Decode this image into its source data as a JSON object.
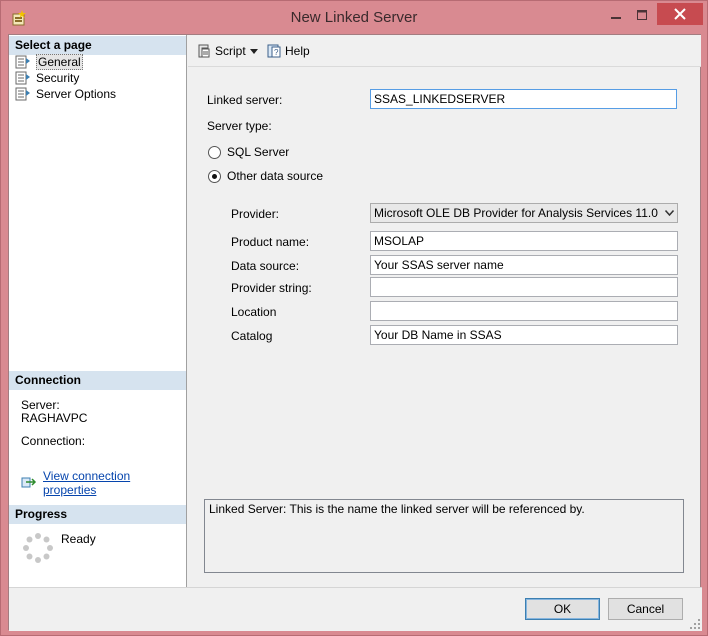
{
  "window": {
    "title": "New Linked Server"
  },
  "left": {
    "select_page_header": "Select a page",
    "pages": [
      {
        "label": "General",
        "selected": true
      },
      {
        "label": "Security",
        "selected": false
      },
      {
        "label": "Server Options",
        "selected": false
      }
    ],
    "connection_header": "Connection",
    "server_label": "Server:",
    "server_value": "RAGHAVPC",
    "connection_label": "Connection:",
    "view_connection_link": "View connection properties",
    "progress_header": "Progress",
    "progress_status": "Ready"
  },
  "toolbar": {
    "script_label": "Script",
    "help_label": "Help"
  },
  "form": {
    "linked_server_label": "Linked server:",
    "linked_server_value": "SSAS_LINKEDSERVER",
    "server_type_label": "Server type:",
    "radio_sql_server": "SQL Server",
    "radio_other": "Other data source",
    "selected_server_type": "Other data source",
    "provider_label": "Provider:",
    "provider_value": "Microsoft OLE DB Provider for Analysis Services 11.0",
    "product_name_label": "Product name:",
    "product_name_value": "MSOLAP",
    "data_source_label": "Data source:",
    "data_source_value": "Your SSAS server name",
    "provider_string_label": "Provider string:",
    "provider_string_value": "",
    "location_label": "Location",
    "location_value": "",
    "catalog_label": "Catalog",
    "catalog_value": "Your DB Name in SSAS"
  },
  "description": {
    "text": "Linked Server: This is the name the linked server will be referenced by."
  },
  "buttons": {
    "ok": "OK",
    "cancel": "Cancel"
  },
  "colors": {
    "titlebar": "#d98a91",
    "close_button": "#c74b50",
    "section_header": "#d6e3ef",
    "link": "#0645ad"
  }
}
